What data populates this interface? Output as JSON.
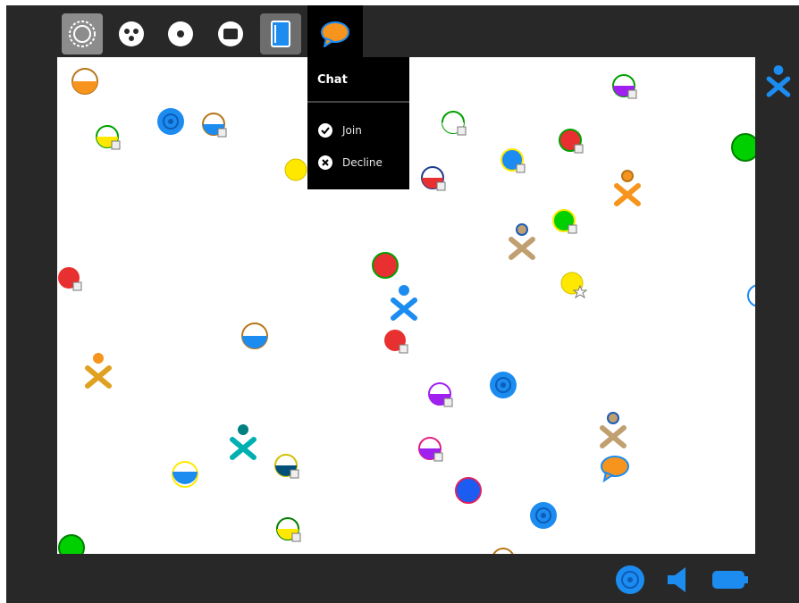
{
  "toolbar": {
    "tabs": [
      {
        "name": "neighborhood-view",
        "icon": "neighborhood-icon",
        "state": "active"
      },
      {
        "name": "group-view",
        "icon": "group-icon",
        "state": "normal"
      },
      {
        "name": "home-view",
        "icon": "home-icon",
        "state": "normal"
      },
      {
        "name": "activity-view",
        "icon": "activity-icon",
        "state": "normal"
      },
      {
        "name": "journal",
        "icon": "journal-icon",
        "state": "selected"
      },
      {
        "name": "chat-invite",
        "icon": "chat-icon",
        "state": "open"
      }
    ]
  },
  "palette": {
    "title": "Chat",
    "items": [
      {
        "label": "Join",
        "icon": "check-icon"
      },
      {
        "label": "Decline",
        "icon": "cancel-icon"
      }
    ]
  },
  "frame_device": {
    "icon": "xo-buddy-icon",
    "color": "#1c8cf0"
  },
  "bottom_devices": [
    {
      "icon": "network-icon",
      "color": "#1c8cf0"
    },
    {
      "icon": "speaker-icon",
      "color": "#1c8cf0"
    },
    {
      "icon": "battery-icon",
      "color": "#1c8cf0"
    }
  ],
  "colors": {
    "frame": "#282828",
    "accent": "#1c8cf0"
  }
}
